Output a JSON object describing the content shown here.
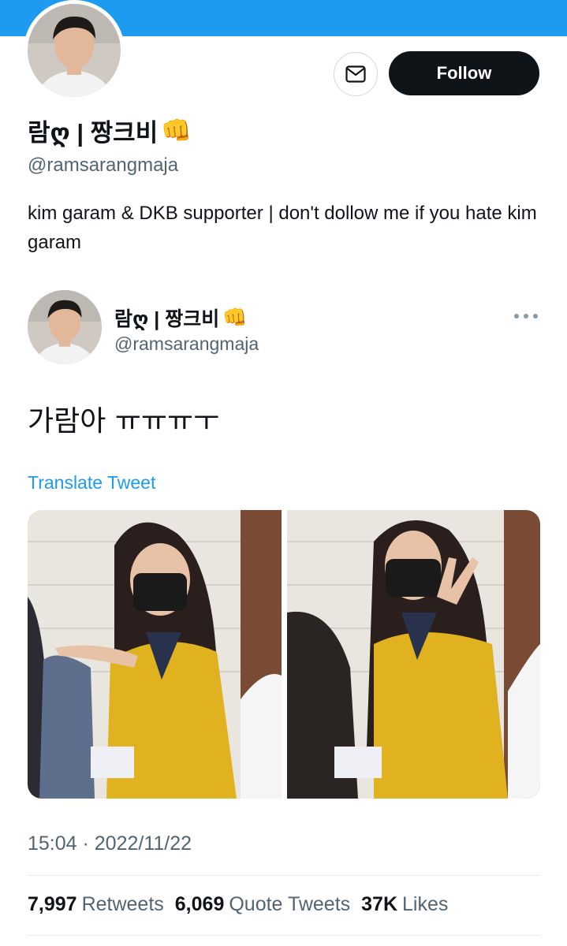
{
  "profile": {
    "display_name": "람ღ | 짱크비",
    "name_emoji": "👊",
    "handle": "@ramsarangmaja",
    "bio": "kim garam & DKB supporter | don't dollow me if you hate kim garam",
    "follow_label": "Follow",
    "message_icon": "mail-icon"
  },
  "tweet": {
    "display_name": "람ღ | 짱크비",
    "name_emoji": "👊",
    "handle": "@ramsarangmaja",
    "text": "가람아 ㅠㅠㅠㅜ",
    "translate_label": "Translate Tweet",
    "more_icon": "more-horizontal-icon",
    "media_count": 2,
    "timestamp": "15:04 · 2022/11/22",
    "stats": {
      "retweets_count": "7,997",
      "retweets_label": "Retweets",
      "quotes_count": "6,069",
      "quotes_label": "Quote Tweets",
      "likes_count": "37K",
      "likes_label": "Likes"
    }
  },
  "colors": {
    "banner": "#1d9bf0",
    "link": "#1d9bf0",
    "follow_bg": "#0f1419",
    "secondary_text": "#536471"
  }
}
